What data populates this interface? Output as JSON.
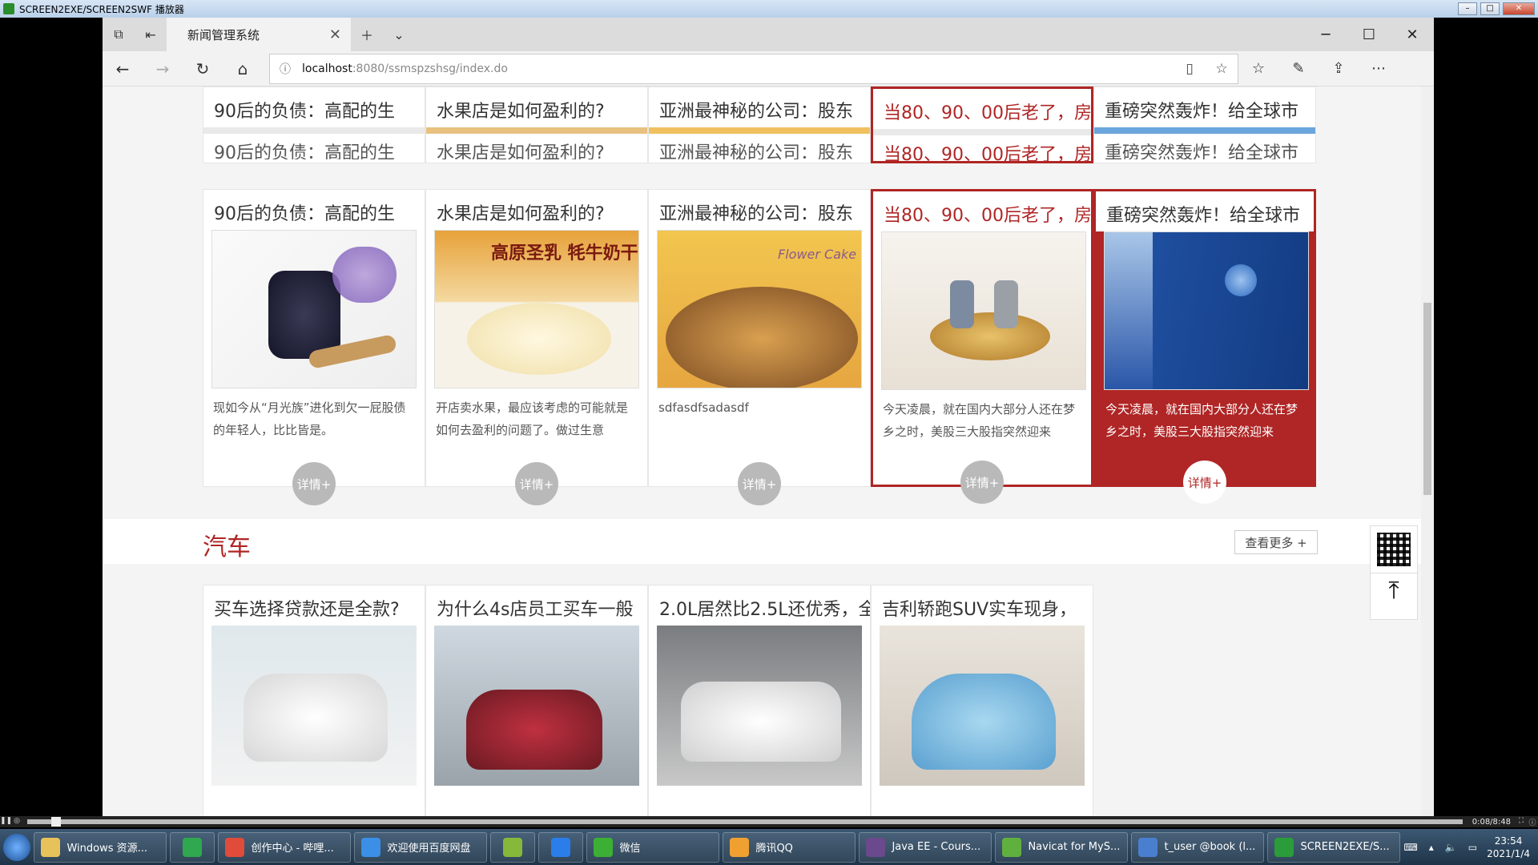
{
  "player": {
    "title": "SCREEN2EXE/SCREEN2SWF 播放器",
    "time": "0:08/8:48"
  },
  "browser": {
    "tab_title": "新闻管理系统",
    "url_host": "localhost",
    "url_path": ":8080/ssmspzshsg/index.do"
  },
  "top_row": [
    {
      "title": "90后的负债：高配的生",
      "title2": "90后的负债：高配的生"
    },
    {
      "title": "水果店是如何盈利的?",
      "title2": "水果店是如何盈利的?"
    },
    {
      "title": "亚洲最神秘的公司：股东",
      "title2": "亚洲最神秘的公司：股东"
    },
    {
      "title": "当80、90、00后老了，房",
      "title2": "当80、90、00后老了，房"
    },
    {
      "title": "重磅突然轰炸！给全球市",
      "title2": "重磅突然轰炸！给全球市"
    }
  ],
  "main_row": [
    {
      "title": "90后的负债：高配的生",
      "desc": "现如今从“月光族”进化到欠一屁股债的年轻人，比比皆是。",
      "detail": "详情+"
    },
    {
      "title": "水果店是如何盈利的?",
      "desc": "开店卖水果，最应该考虑的可能就是如何去盈利的问题了。做过生意",
      "detail": "详情+",
      "img_text": "高原圣乳 牦牛奶干"
    },
    {
      "title": "亚洲最神秘的公司：股东",
      "desc": "sdfasdfsadasdf",
      "detail": "详情+",
      "img_text": "Flower Cake"
    },
    {
      "title": "当80、90、00后老了，房",
      "desc": "今天凌晨，就在国内大部分人还在梦乡之时，美股三大股指突然迎来",
      "detail": "详情+"
    },
    {
      "title": "重磅突然轰炸！给全球市",
      "desc": "今天凌晨，就在国内大部分人还在梦乡之时，美股三大股指突然迎来",
      "detail": "详情+"
    }
  ],
  "car_section": {
    "title": "汽车",
    "more": "查看更多 +",
    "items": [
      {
        "title": "买车选择贷款还是全款?"
      },
      {
        "title": "为什么4s店员工买车一般"
      },
      {
        "title": "2.0L居然比2.5L还优秀，全"
      },
      {
        "title": "吉利轿跑SUV实车现身，"
      }
    ]
  },
  "taskbar": {
    "items": [
      {
        "label": "Windows 资源...",
        "color": "#e7c25a"
      },
      {
        "label": "",
        "color": "#2fa84f"
      },
      {
        "label": "创作中心 - 哔哩...",
        "color": "#e04b3a"
      },
      {
        "label": "欢迎使用百度网盘",
        "color": "#3b8fe6"
      },
      {
        "label": "",
        "color": "#86b83a"
      },
      {
        "label": "",
        "color": "#2b7de9"
      },
      {
        "label": "微信",
        "color": "#3cb034"
      },
      {
        "label": "腾讯QQ",
        "color": "#f0a030"
      },
      {
        "label": "Java EE - Cours...",
        "color": "#6a4a8c"
      },
      {
        "label": "Navicat for MyS...",
        "color": "#60b040"
      },
      {
        "label": "t_user @book (l...",
        "color": "#4a7fd0"
      },
      {
        "label": "SCREEN2EXE/S...",
        "color": "#2a9c3a"
      }
    ],
    "time": "23:54",
    "date": "2021/1/4"
  }
}
